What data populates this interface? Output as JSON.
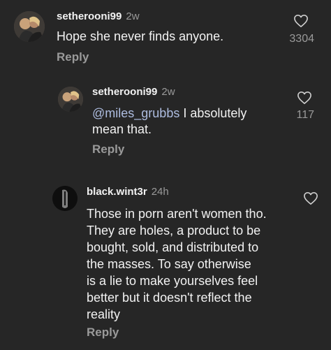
{
  "comments": [
    {
      "username": "setherooni99",
      "time": "2w",
      "text": "Hope she never finds anyone.",
      "likes": "3304",
      "reply_label": "Reply"
    },
    {
      "username": "setherooni99",
      "time": "2w",
      "mention": "@miles_grubbs",
      "text_line1": " I absolutely",
      "text_line2": "mean that.",
      "likes": "117",
      "reply_label": "Reply"
    },
    {
      "username": "black.wint3r",
      "time": "24h",
      "text_lines": [
        "Those in porn aren't women tho.",
        "They are holes, a product to be",
        "bought, sold, and distributed to",
        "the masses. To say otherwise",
        "is a lie to make yourselves feel",
        "better but it doesn't reflect the",
        "reality"
      ],
      "reply_label": "Reply"
    }
  ],
  "colors": {
    "background": "#262626",
    "text": "#f2f2f2",
    "muted": "#9a9a9a",
    "mention": "#aebde0"
  },
  "icons": {
    "like": "heart-outline-icon"
  }
}
